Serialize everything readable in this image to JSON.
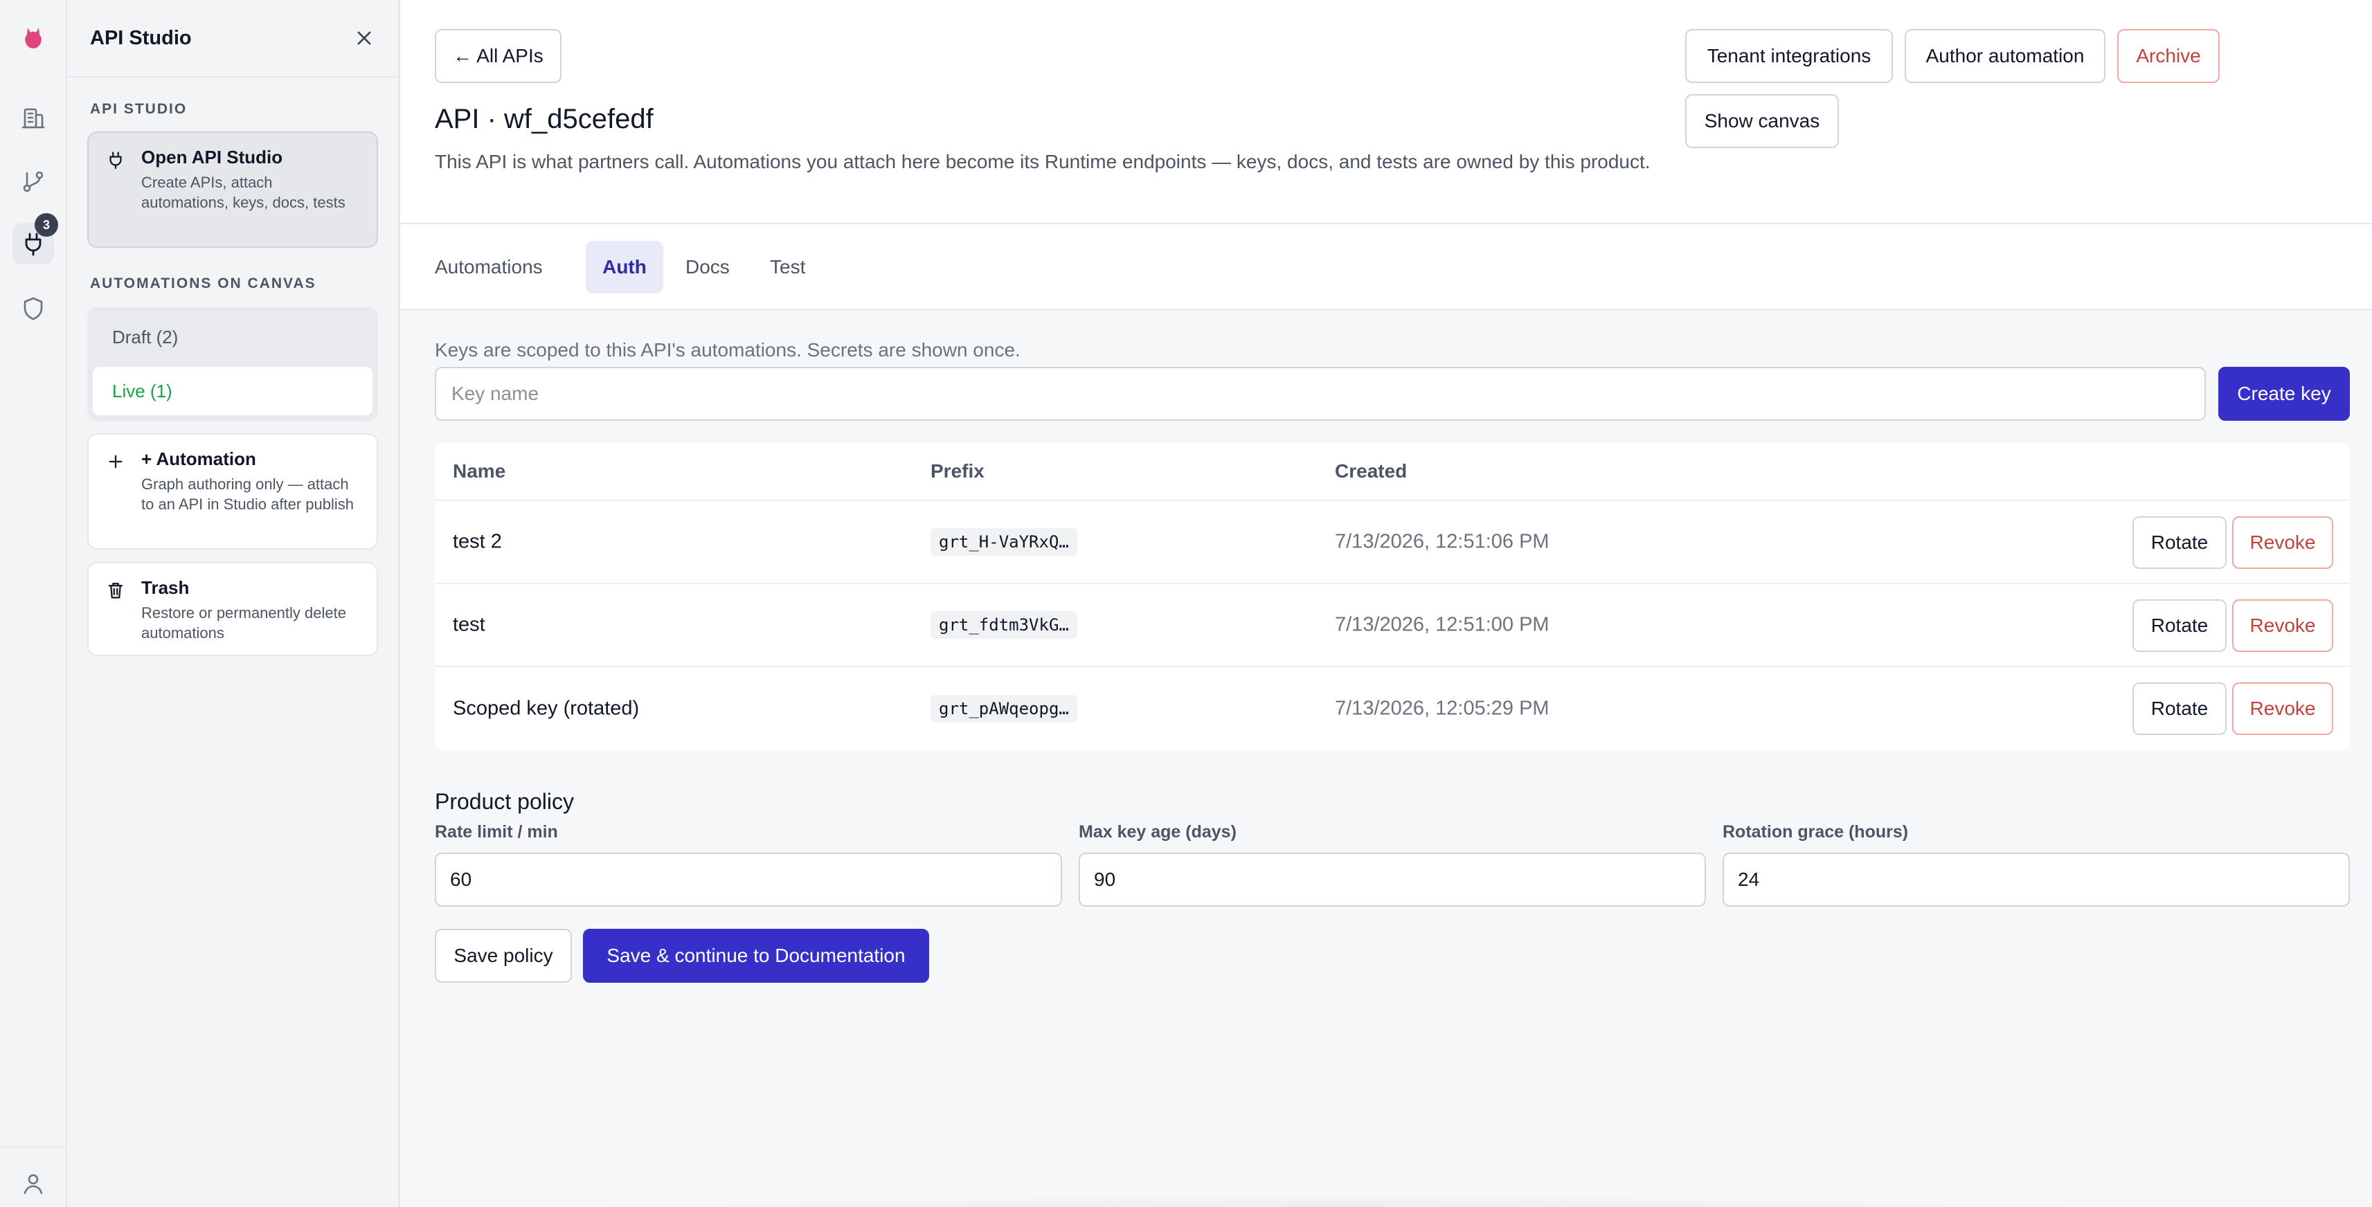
{
  "rail": {
    "badge_count": "3",
    "accent": "#e0457b"
  },
  "sidebar": {
    "title": "API Studio",
    "section_api_studio": "API STUDIO",
    "open_studio": {
      "title": "Open API Studio",
      "desc": "Create APIs, attach automations, keys, docs, tests"
    },
    "section_automations": "AUTOMATIONS ON CANVAS",
    "filters": {
      "draft": "Draft (2)",
      "live": "Live (1)"
    },
    "add_automation": {
      "title": "+ Automation",
      "desc": "Graph authoring only — attach to an API in Studio after publish"
    },
    "trash": {
      "title": "Trash",
      "desc": "Restore or permanently delete automations"
    }
  },
  "header": {
    "back_label": "← All APIs",
    "title": "API · wf_d5cefedf",
    "description": "This API is what partners call. Automations you attach here become its Runtime endpoints — keys, docs, and tests are owned by this product.",
    "actions": {
      "tenant_integrations": "Tenant integrations",
      "author_automation": "Author automation",
      "archive": "Archive",
      "show_canvas": "Show canvas"
    }
  },
  "tabs": [
    {
      "label": "Automations"
    },
    {
      "label": "Auth"
    },
    {
      "label": "Docs"
    },
    {
      "label": "Test"
    }
  ],
  "auth": {
    "hint": "Keys are scoped to this API's automations. Secrets are shown once.",
    "key_name_placeholder": "Key name",
    "create_key_label": "Create key",
    "columns": {
      "name": "Name",
      "prefix": "Prefix",
      "created": "Created"
    },
    "keys": [
      {
        "name": "test 2",
        "prefix": "grt_H-VaYRxQ…",
        "created": "7/13/2026, 12:51:06 PM"
      },
      {
        "name": "test",
        "prefix": "grt_fdtm3VkG…",
        "created": "7/13/2026, 12:51:00 PM"
      },
      {
        "name": "Scoped key (rotated)",
        "prefix": "grt_pAWqeopg…",
        "created": "7/13/2026, 12:05:29 PM"
      }
    ],
    "rotate_label": "Rotate",
    "revoke_label": "Revoke"
  },
  "policy": {
    "title": "Product policy",
    "rate_limit_label": "Rate limit / min",
    "rate_limit_value": "60",
    "max_key_age_label": "Max key age (days)",
    "max_key_age_value": "90",
    "rotation_grace_label": "Rotation grace (hours)",
    "rotation_grace_value": "24",
    "save_label": "Save policy",
    "save_continue_label": "Save & continue to Documentation"
  },
  "colors": {
    "primary": "#3730c8",
    "danger": "#c2413a",
    "live": "#16a34a"
  }
}
